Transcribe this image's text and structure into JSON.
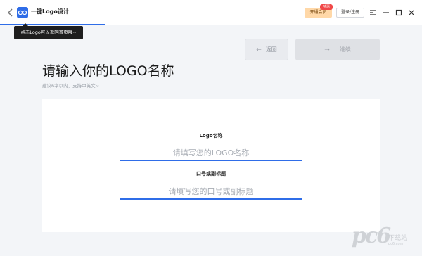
{
  "titlebar": {
    "app_title": "一键Logo设计",
    "vip_label": "开通会员",
    "vip_badge": "特惠",
    "login_label": "登录/注册"
  },
  "tooltip": {
    "text": "点击Logo可以返回首页哦~"
  },
  "nav": {
    "back_label": "返回",
    "next_label": "继续"
  },
  "heading": {
    "title": "请输入你的LOGO名称",
    "subtitle": "建议6字以内，支持中英文~"
  },
  "form": {
    "logo_name": {
      "label": "Logo名称",
      "value": "",
      "placeholder": "请填写您的LOGO名称"
    },
    "slogan": {
      "label": "口号或副标题",
      "value": "",
      "placeholder": "请填写您的口号或副标题"
    }
  },
  "watermark": {
    "letters": "pc6",
    "text": "下载站",
    "url": "pc6.com"
  },
  "colors": {
    "accent": "#2f6de8",
    "vip_bg": "#ffd8a8",
    "badge": "#f04848"
  },
  "icons": [
    "chevron-left-icon",
    "logo-icon",
    "menu-icon",
    "minimize-icon",
    "maximize-icon",
    "close-icon"
  ]
}
